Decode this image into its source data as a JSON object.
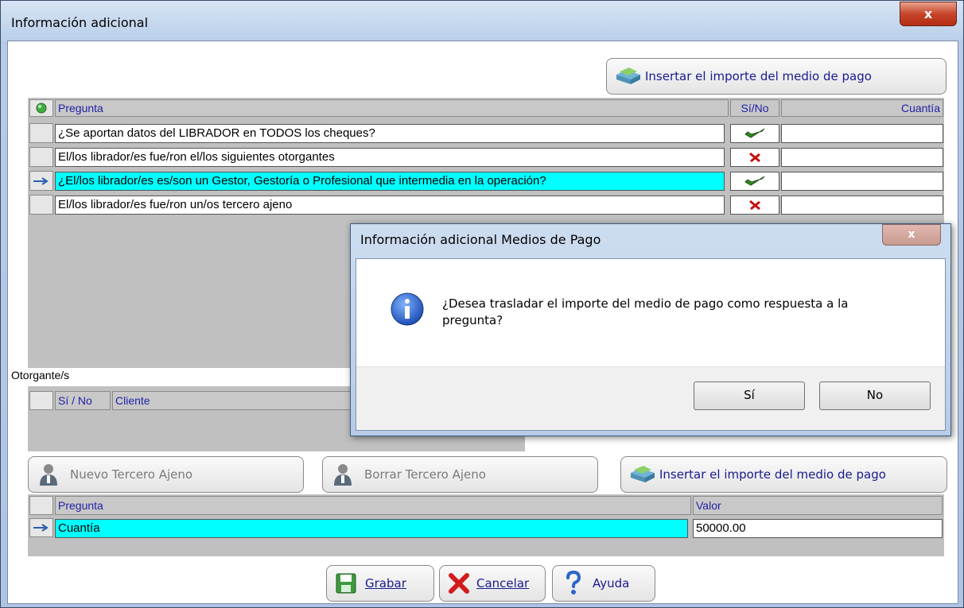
{
  "window": {
    "title": "Información adicional",
    "close_glyph": "x"
  },
  "top_insert_button": {
    "label": "Insertar el importe del medio de pago",
    "icon": "insert-money-icon"
  },
  "questions_grid": {
    "headers": {
      "question": "Pregunta",
      "yesno": "Sí/No",
      "amount": "Cuantía"
    },
    "rows": [
      {
        "question": "¿Se aportan datos del LIBRADOR en TODOS los cheques?",
        "answer": "check",
        "amount": "",
        "highlighted": false,
        "current": false
      },
      {
        "question": "El/los librador/es fue/ron el/los siguientes otorgantes",
        "answer": "cross",
        "amount": "",
        "highlighted": false,
        "current": false
      },
      {
        "question": "¿El/los librador/es es/son un Gestor, Gestoría o Profesional que intermedia en la operación?",
        "answer": "check",
        "amount": "",
        "highlighted": true,
        "current": true
      },
      {
        "question": "El/los librador/es fue/ron un/os tercero ajeno",
        "answer": "cross",
        "amount": "",
        "highlighted": false,
        "current": false
      }
    ]
  },
  "otorgantes": {
    "label": "Otorgante/s",
    "headers": {
      "yesno": "Sí / No",
      "client": "Cliente"
    }
  },
  "action_buttons": {
    "new_third": "Nuevo Tercero Ajeno",
    "delete_third": "Borrar Tercero Ajeno",
    "insert_amount": "Insertar el importe del medio de pago"
  },
  "value_grid": {
    "headers": {
      "question": "Pregunta",
      "value": "Valor"
    },
    "rows": [
      {
        "question": "Cuantía",
        "value": "50000.00"
      }
    ]
  },
  "footer_buttons": {
    "save": "Grabar",
    "cancel": "Cancelar",
    "help": "Ayuda"
  },
  "dialog": {
    "title": "Información adicional Medios de Pago",
    "message": "¿Desea trasladar el importe del medio de pago como respuesta a la pregunta?",
    "yes": "Sí",
    "no": "No",
    "close_glyph": "x",
    "icon": "info-icon"
  },
  "colors": {
    "highlight": "#00ffff",
    "header_text": "#1f1fa8",
    "check": "#2e8b1e",
    "cross": "#c41010"
  }
}
